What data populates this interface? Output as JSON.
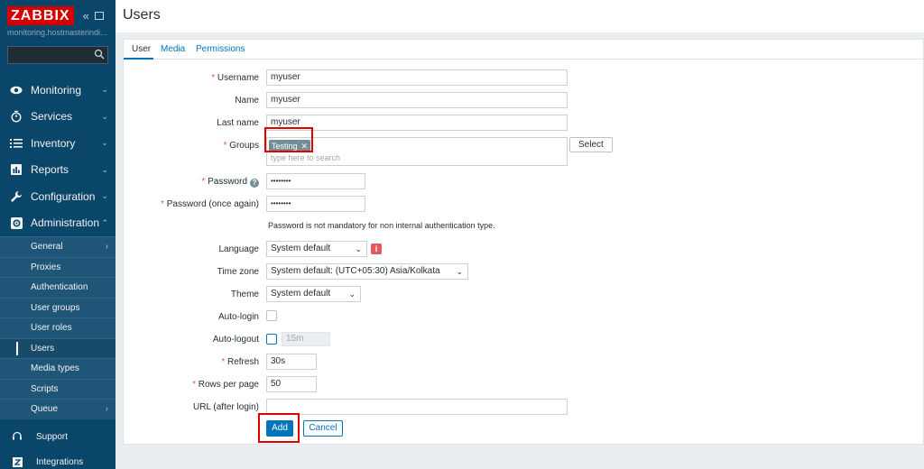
{
  "sidebar": {
    "logo": "ZABBIX",
    "hostname": "monitoring.hostmasterindi...",
    "search_placeholder": "",
    "menu": [
      {
        "label": "Monitoring",
        "icon": "eye-icon"
      },
      {
        "label": "Services",
        "icon": "timer-icon"
      },
      {
        "label": "Inventory",
        "icon": "list-icon"
      },
      {
        "label": "Reports",
        "icon": "bar-chart-icon"
      },
      {
        "label": "Configuration",
        "icon": "wrench-icon"
      },
      {
        "label": "Administration",
        "icon": "gear-icon"
      }
    ],
    "admin_submenu": [
      "General",
      "Proxies",
      "Authentication",
      "User groups",
      "User roles",
      "Users",
      "Media types",
      "Scripts",
      "Queue"
    ],
    "bottom": [
      {
        "label": "Support",
        "icon": "headset-icon"
      },
      {
        "label": "Integrations",
        "icon": "zabbix-z-icon"
      }
    ]
  },
  "page": {
    "title": "Users"
  },
  "tabs": [
    "User",
    "Media",
    "Permissions"
  ],
  "form": {
    "username_label": "Username",
    "username_value": "myuser",
    "name_label": "Name",
    "name_value": "myuser",
    "lastname_label": "Last name",
    "lastname_value": "myuser",
    "groups_label": "Groups",
    "group_chip": "Testing",
    "groups_placeholder": "type here to search",
    "select_button": "Select",
    "password_label": "Password",
    "password_value": "••••••••",
    "password2_label": "Password (once again)",
    "password2_value": "••••••••",
    "password_note": "Password is not mandatory for non internal authentication type.",
    "language_label": "Language",
    "language_value": "System default",
    "timezone_label": "Time zone",
    "timezone_value": "System default: (UTC+05:30) Asia/Kolkata",
    "theme_label": "Theme",
    "theme_value": "System default",
    "autologin_label": "Auto-login",
    "autologout_label": "Auto-logout",
    "autologout_value": "15m",
    "refresh_label": "Refresh",
    "refresh_value": "30s",
    "rows_label": "Rows per page",
    "rows_value": "50",
    "url_label": "URL (after login)",
    "url_value": "",
    "add_button": "Add",
    "cancel_button": "Cancel"
  },
  "colors": {
    "sidebar_bg": "#0a466a",
    "submenu_bg": "#1f5577",
    "accent": "#0275b8",
    "required": "#e45959",
    "highlight": "#e00000"
  }
}
